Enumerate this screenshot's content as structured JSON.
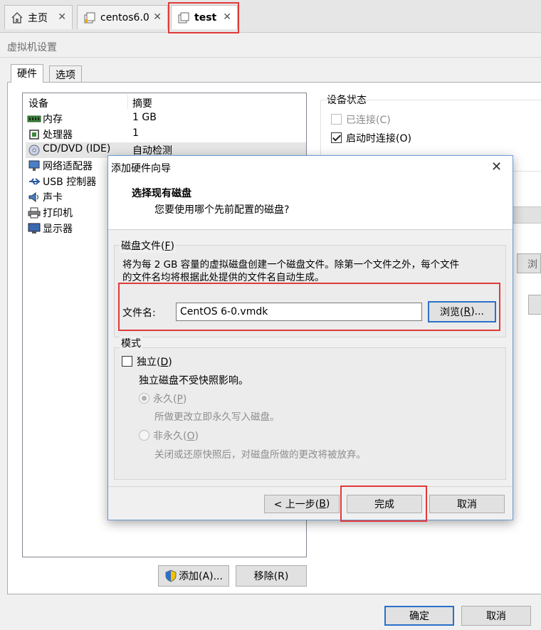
{
  "tabs": [
    {
      "label": "主页",
      "icon": "home-icon"
    },
    {
      "label": "centos6.0",
      "icon": "vm-icon"
    },
    {
      "label": "test",
      "icon": "vm-copy-icon"
    }
  ],
  "window_title": "虚拟机设置",
  "settings_tabs": [
    "硬件",
    "选项"
  ],
  "device_list": {
    "headers": {
      "device": "设备",
      "summary": "摘要"
    },
    "rows": [
      {
        "name": "内存",
        "summary": "1 GB",
        "icon": "memory-icon"
      },
      {
        "name": "处理器",
        "summary": "1",
        "icon": "cpu-icon"
      },
      {
        "name": "CD/DVD (IDE)",
        "summary": "自动检测",
        "icon": "cd-icon"
      },
      {
        "name": "网络适配器",
        "summary": "",
        "icon": "network-icon"
      },
      {
        "name": "USB 控制器",
        "summary": "",
        "icon": "usb-icon"
      },
      {
        "name": "声卡",
        "summary": "",
        "icon": "sound-icon"
      },
      {
        "name": "打印机",
        "summary": "",
        "icon": "printer-icon"
      },
      {
        "name": "显示器",
        "summary": "",
        "icon": "monitor-icon"
      }
    ]
  },
  "device_status": {
    "title": "设备状态",
    "connected": {
      "label": "已连接(C)",
      "checked": false
    },
    "connect_at_power_on": {
      "label": "启动时连接(O)",
      "checked": true
    },
    "partial_button": "浏"
  },
  "list_buttons": {
    "add": "添加(A)...",
    "remove": "移除(R)"
  },
  "bottom_buttons": {
    "ok": "确定",
    "cancel": "取消"
  },
  "dialog": {
    "title": "添加硬件向导",
    "close": "✕",
    "heading": "选择现有磁盘",
    "subheading": "您要使用哪个先前配置的磁盘?",
    "disk_file_group": {
      "label_pre": "磁盘文件(",
      "label_key": "F",
      "label_post": ")",
      "description_line1": "将为每 2 GB 容量的虚拟磁盘创建一个磁盘文件。除第一个文件之外，每个文件",
      "description_line2": "的文件名均将根据此处提供的文件名自动生成。",
      "file_label": "文件名:",
      "file_value": "CentOS 6-0.vmdk",
      "browse_pre": "浏览(",
      "browse_key": "R",
      "browse_post": ")..."
    },
    "mode_group": {
      "label": "模式",
      "independent_pre": "独立(",
      "independent_key": "D",
      "independent_post": ")",
      "independent_desc": "独立磁盘不受快照影响。",
      "persistent_pre": "永久(",
      "persistent_key": "P",
      "persistent_post": ")",
      "persistent_desc": "所做更改立即永久写入磁盘。",
      "nonpersistent_pre": "非永久(",
      "nonpersistent_key": "O",
      "nonpersistent_post": ")",
      "nonpersistent_desc": "关闭或还原快照后，对磁盘所做的更改将被放弃。"
    },
    "buttons": {
      "back_pre": "< 上一步(",
      "back_key": "B",
      "back_post": ")",
      "finish": "完成",
      "cancel": "取消"
    }
  },
  "colors": {
    "highlight": "#e03a3a",
    "accent": "#2a70c9"
  }
}
